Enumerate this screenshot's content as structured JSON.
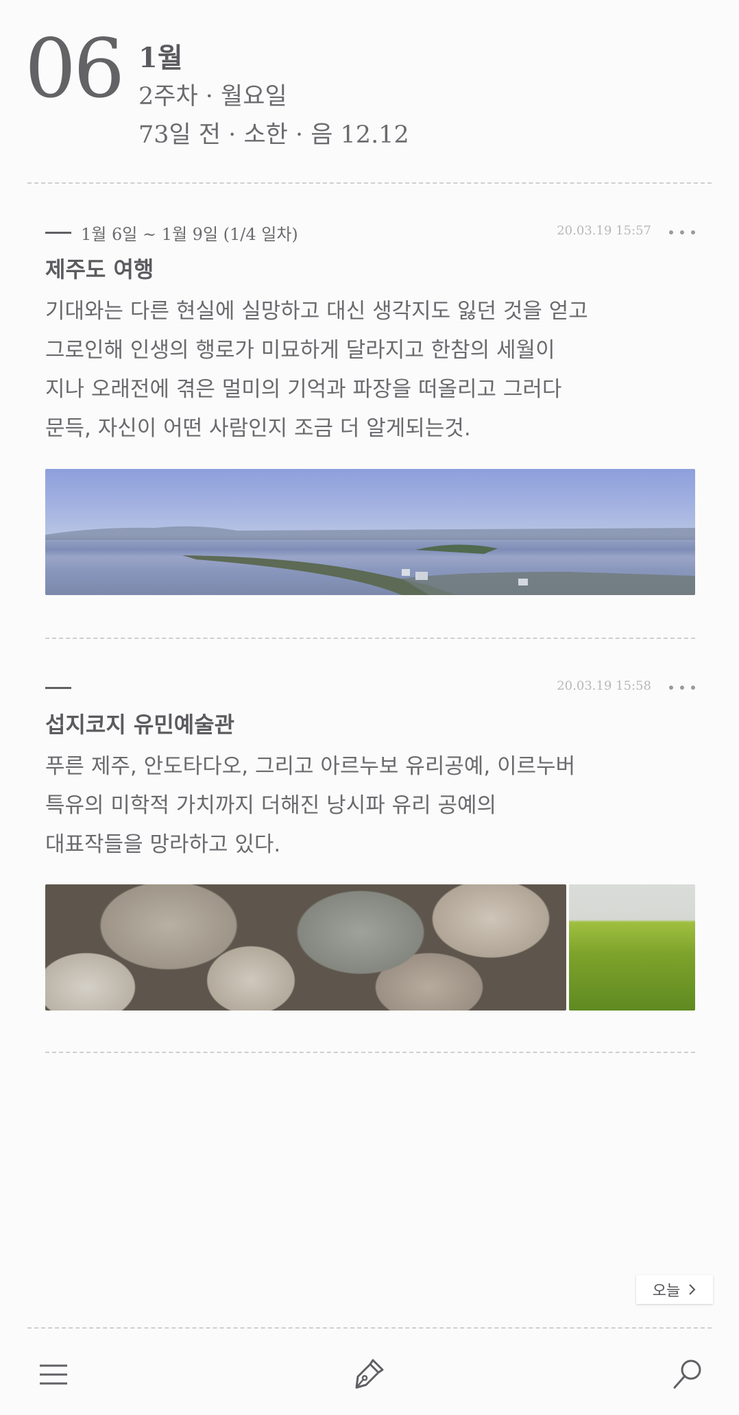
{
  "header": {
    "day": "06",
    "month": "1월",
    "week": "2주차 · 월요일",
    "info": "73일 전 · 소한 · 음 12.12"
  },
  "entries": [
    {
      "range": "1월 6일 ~ 1월 9일 (1/4 일차)",
      "time": "20.03.19 15:57",
      "title": "제주도 여행",
      "body_lines": [
        "기대와는 다른 현실에 실망하고 대신 생각지도 잃던 것을 얻고",
        "그로인해 인생의 행로가 미묘하게 달라지고 한참의 세월이",
        "지나 오래전에 겪은 멀미의 기억과 파장을 떠올리고 그러다",
        "문득, 자신이 어떤 사람인지 조금 더 알게되는것."
      ]
    },
    {
      "range": "",
      "time": "20.03.19 15:58",
      "title": "섭지코지 유민예술관",
      "body_lines": [
        "푸른 제주, 안도타다오, 그리고 아르누보 유리공예, 이르누버",
        "특유의 미학적 가치까지 더해진 낭시파 유리 공예의",
        "대표작들을 망라하고 있다."
      ]
    }
  ],
  "today_button": {
    "label": "오늘"
  },
  "bottom_nav": {
    "items": [
      {
        "icon": "menu-icon"
      },
      {
        "icon": "pen-icon"
      },
      {
        "icon": "search-icon"
      }
    ]
  }
}
